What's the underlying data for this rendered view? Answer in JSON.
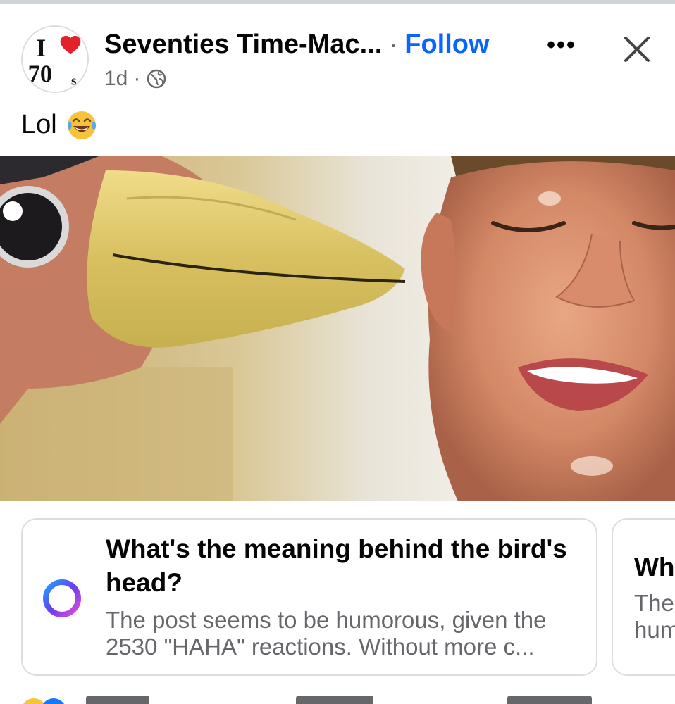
{
  "post": {
    "page_name": "Seventies Time-Mac...",
    "separator": "·",
    "follow_label": "Follow",
    "time": "1d",
    "meta_separator": "·",
    "audience_icon": "globe-icon",
    "more_icon": "more-options-icon",
    "more_label": "•••",
    "close_icon": "close-icon",
    "avatar_text": {
      "line1": "I",
      "line2": "70",
      "line2_suffix": "s"
    },
    "text": "Lol",
    "text_emoji": "tears-of-joy-emoji"
  },
  "ai_suggestions": [
    {
      "question": "What's the meaning behind the bird's head?",
      "answer": "The post seems to be humorous, given the 2530 \"HAHA\" reactions. Without more c..."
    },
    {
      "question": "Wh",
      "answer_line1": "The",
      "answer_line2": "hum"
    }
  ],
  "colors": {
    "follow_blue": "#0866ff",
    "secondary_text": "#65676b",
    "heart_red": "#e4202b",
    "card_border": "#dadde1"
  }
}
